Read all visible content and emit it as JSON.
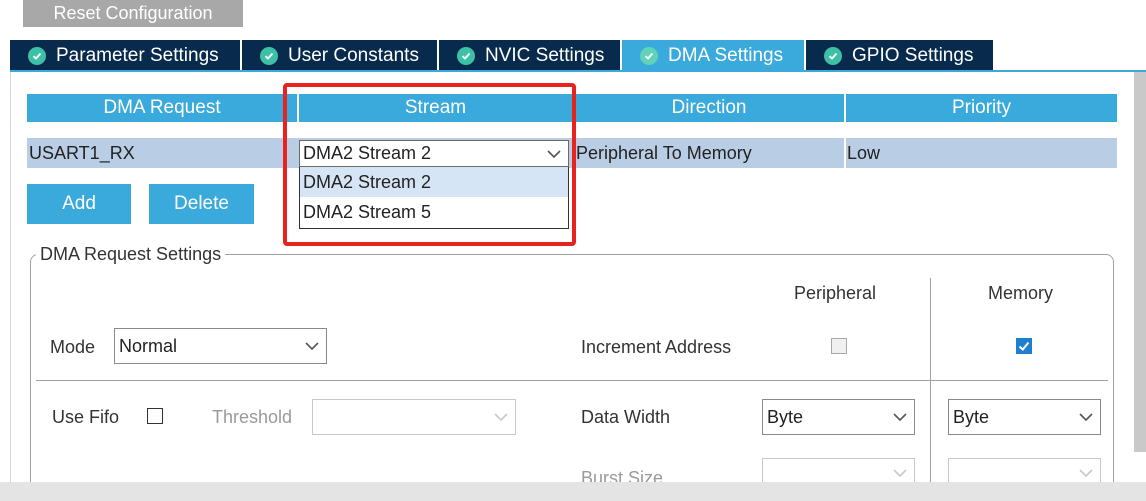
{
  "toolbar": {
    "reset_label": "Reset Configuration"
  },
  "tabs": [
    {
      "label": "Parameter Settings"
    },
    {
      "label": "User Constants"
    },
    {
      "label": "NVIC Settings"
    },
    {
      "label": "DMA Settings"
    },
    {
      "label": "GPIO Settings"
    }
  ],
  "active_tab": "DMA Settings",
  "table": {
    "headers": [
      "DMA Request",
      "Stream",
      "Direction",
      "Priority"
    ],
    "rows": [
      {
        "request": "USART1_RX",
        "stream": "DMA2 Stream 2",
        "direction": "Peripheral To Memory",
        "priority": "Low"
      }
    ],
    "stream_options": [
      "DMA2 Stream 2",
      "DMA2 Stream 5"
    ]
  },
  "buttons": {
    "add": "Add",
    "delete": "Delete"
  },
  "settings": {
    "legend": "DMA Request Settings",
    "col_peripheral": "Peripheral",
    "col_memory": "Memory",
    "mode_label": "Mode",
    "mode_value": "Normal",
    "increment_label": "Increment Address",
    "peripheral_increment": false,
    "memory_increment": true,
    "use_fifo_label": "Use Fifo",
    "use_fifo": false,
    "threshold_label": "Threshold",
    "threshold_value": "",
    "data_width_label": "Data Width",
    "peripheral_width": "Byte",
    "memory_width": "Byte",
    "burst_size_label": "Burst Size"
  },
  "colors": {
    "tab_dark": "#082a4c",
    "tab_active": "#3aa9dc",
    "row_selected": "#b9cde4",
    "highlight": "#e8231f"
  },
  "icons": [
    "check-circle-icon",
    "chevron-down-icon",
    "checkmark-icon"
  ]
}
